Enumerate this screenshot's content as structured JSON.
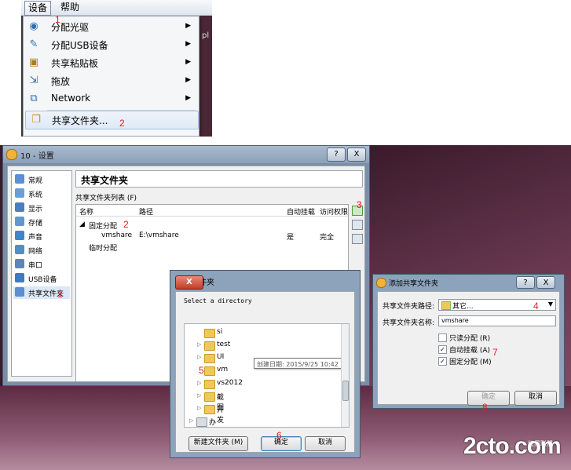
{
  "menu": {
    "devices": "设备",
    "help": "帮助",
    "items": [
      {
        "label": "分配光驱",
        "icon": "optical-disc-icon",
        "submenu": true
      },
      {
        "label": "分配USB设备",
        "icon": "usb-icon",
        "submenu": true
      },
      {
        "label": "共享粘贴板",
        "icon": "clipboard-icon",
        "submenu": true
      },
      {
        "label": "拖放",
        "icon": "drag-drop-icon",
        "submenu": true
      },
      {
        "label": "Network",
        "icon": "network-icon",
        "submenu": true
      },
      {
        "label": "共享文件夹...",
        "icon": "shared-folder-icon",
        "submenu": false
      }
    ],
    "vm_text": "pl"
  },
  "settings": {
    "title": "10 - 设置",
    "help_btn": "?",
    "close_btn": "X",
    "categories": [
      {
        "label": "常规",
        "color": "#5b8fd6"
      },
      {
        "label": "系统",
        "color": "#6aa0d8"
      },
      {
        "label": "显示",
        "color": "#4a7fbf"
      },
      {
        "label": "存储",
        "color": "#5f97cf"
      },
      {
        "label": "声音",
        "color": "#3f86c9"
      },
      {
        "label": "网络",
        "color": "#4d90c8"
      },
      {
        "label": "串口",
        "color": "#5a87b8"
      },
      {
        "label": "USB设备",
        "color": "#3d7cc0"
      },
      {
        "label": "共享文件夹",
        "color": "#5c8ed0"
      }
    ],
    "page_title": "共享文件夹",
    "list_label": "共享文件夹列表 (F)",
    "columns": [
      "名称",
      "路径",
      "自动挂载",
      "访问权限"
    ],
    "group_fixed": "固定分配",
    "row": {
      "name": "vmshare",
      "path": "E:\\vmshare",
      "auto": "是",
      "access": "完全"
    },
    "group_temp": "临时分配"
  },
  "browse": {
    "title": "浏览文件夹",
    "close_btn": "X",
    "prompt": "Select a directory",
    "tree": [
      "si",
      "test",
      "UI",
      "vm",
      "vs2012",
      "截图",
      "开发",
      "办公备份 (F:)"
    ],
    "tooltip": "创建日期: 2015/9/25 10:42",
    "new_folder_btn": "新建文件夹 (M)",
    "ok_btn": "确定",
    "cancel_btn": "取消"
  },
  "addshare": {
    "title": "添加共享文件夹",
    "help_btn": "?",
    "close_btn": "X",
    "path_label": "共享文件夹路径:",
    "path_value": "其它...",
    "name_label": "共享文件夹名称:",
    "name_value": "vmshare",
    "readonly": "只读分配 (R)",
    "automount": "自动挂载 (A)",
    "permanent": "固定分配 (M)",
    "ok_btn": "确定",
    "cancel_btn": "取消"
  },
  "annotations": [
    "1",
    "2",
    "1",
    "2",
    "3",
    "4",
    "5",
    "6",
    "7",
    "8"
  ],
  "watermark": "2cto.com",
  "watermark_sub": "红黑联盟"
}
